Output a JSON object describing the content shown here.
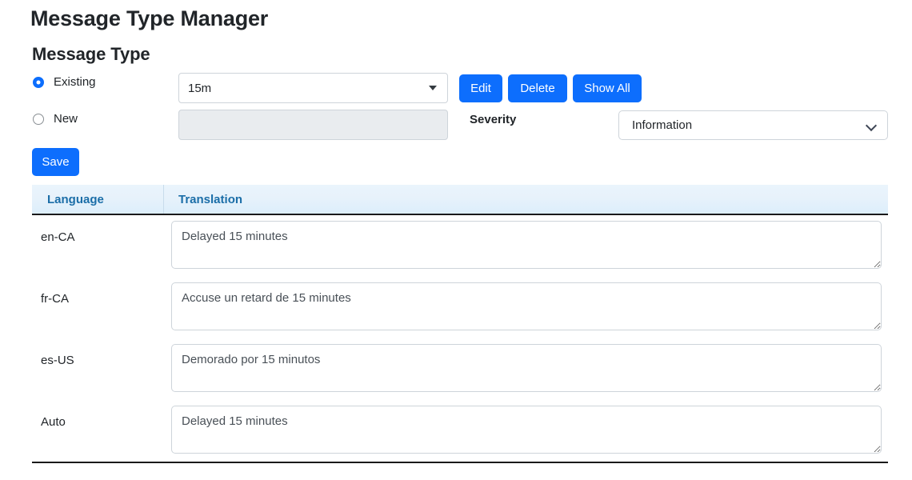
{
  "page_title": "Message Type Manager",
  "section": {
    "title": "Message Type",
    "radios": [
      {
        "label": "Existing",
        "checked": true
      },
      {
        "label": "New",
        "checked": false
      }
    ],
    "existing_select": {
      "value": "15m",
      "icon": "caret-down-icon"
    },
    "new_input": {
      "value": "",
      "placeholder": "",
      "disabled": true
    },
    "buttons": {
      "edit": "Edit",
      "delete": "Delete",
      "show_all": "Show All",
      "save": "Save"
    },
    "severity": {
      "label": "Severity",
      "value": "Information",
      "icon": "chevron-down-icon"
    }
  },
  "table": {
    "headers": {
      "language": "Language",
      "translation": "Translation"
    },
    "rows": [
      {
        "language": "en-CA",
        "translation": "Delayed 15 minutes"
      },
      {
        "language": "fr-CA",
        "translation": "Accuse un retard de 15 minutes"
      },
      {
        "language": "es-US",
        "translation": "Demorado por 15 minutos"
      },
      {
        "language": "Auto",
        "translation": "Delayed 15 minutes"
      }
    ]
  },
  "colors": {
    "primary": "#0d6efd",
    "header_text": "#1b6ea8",
    "header_bg_top": "#eaf4fc",
    "header_bg_bottom": "#dceefb",
    "border": "#ced4da",
    "disabled_bg": "#e9ecef",
    "text": "#212529"
  }
}
